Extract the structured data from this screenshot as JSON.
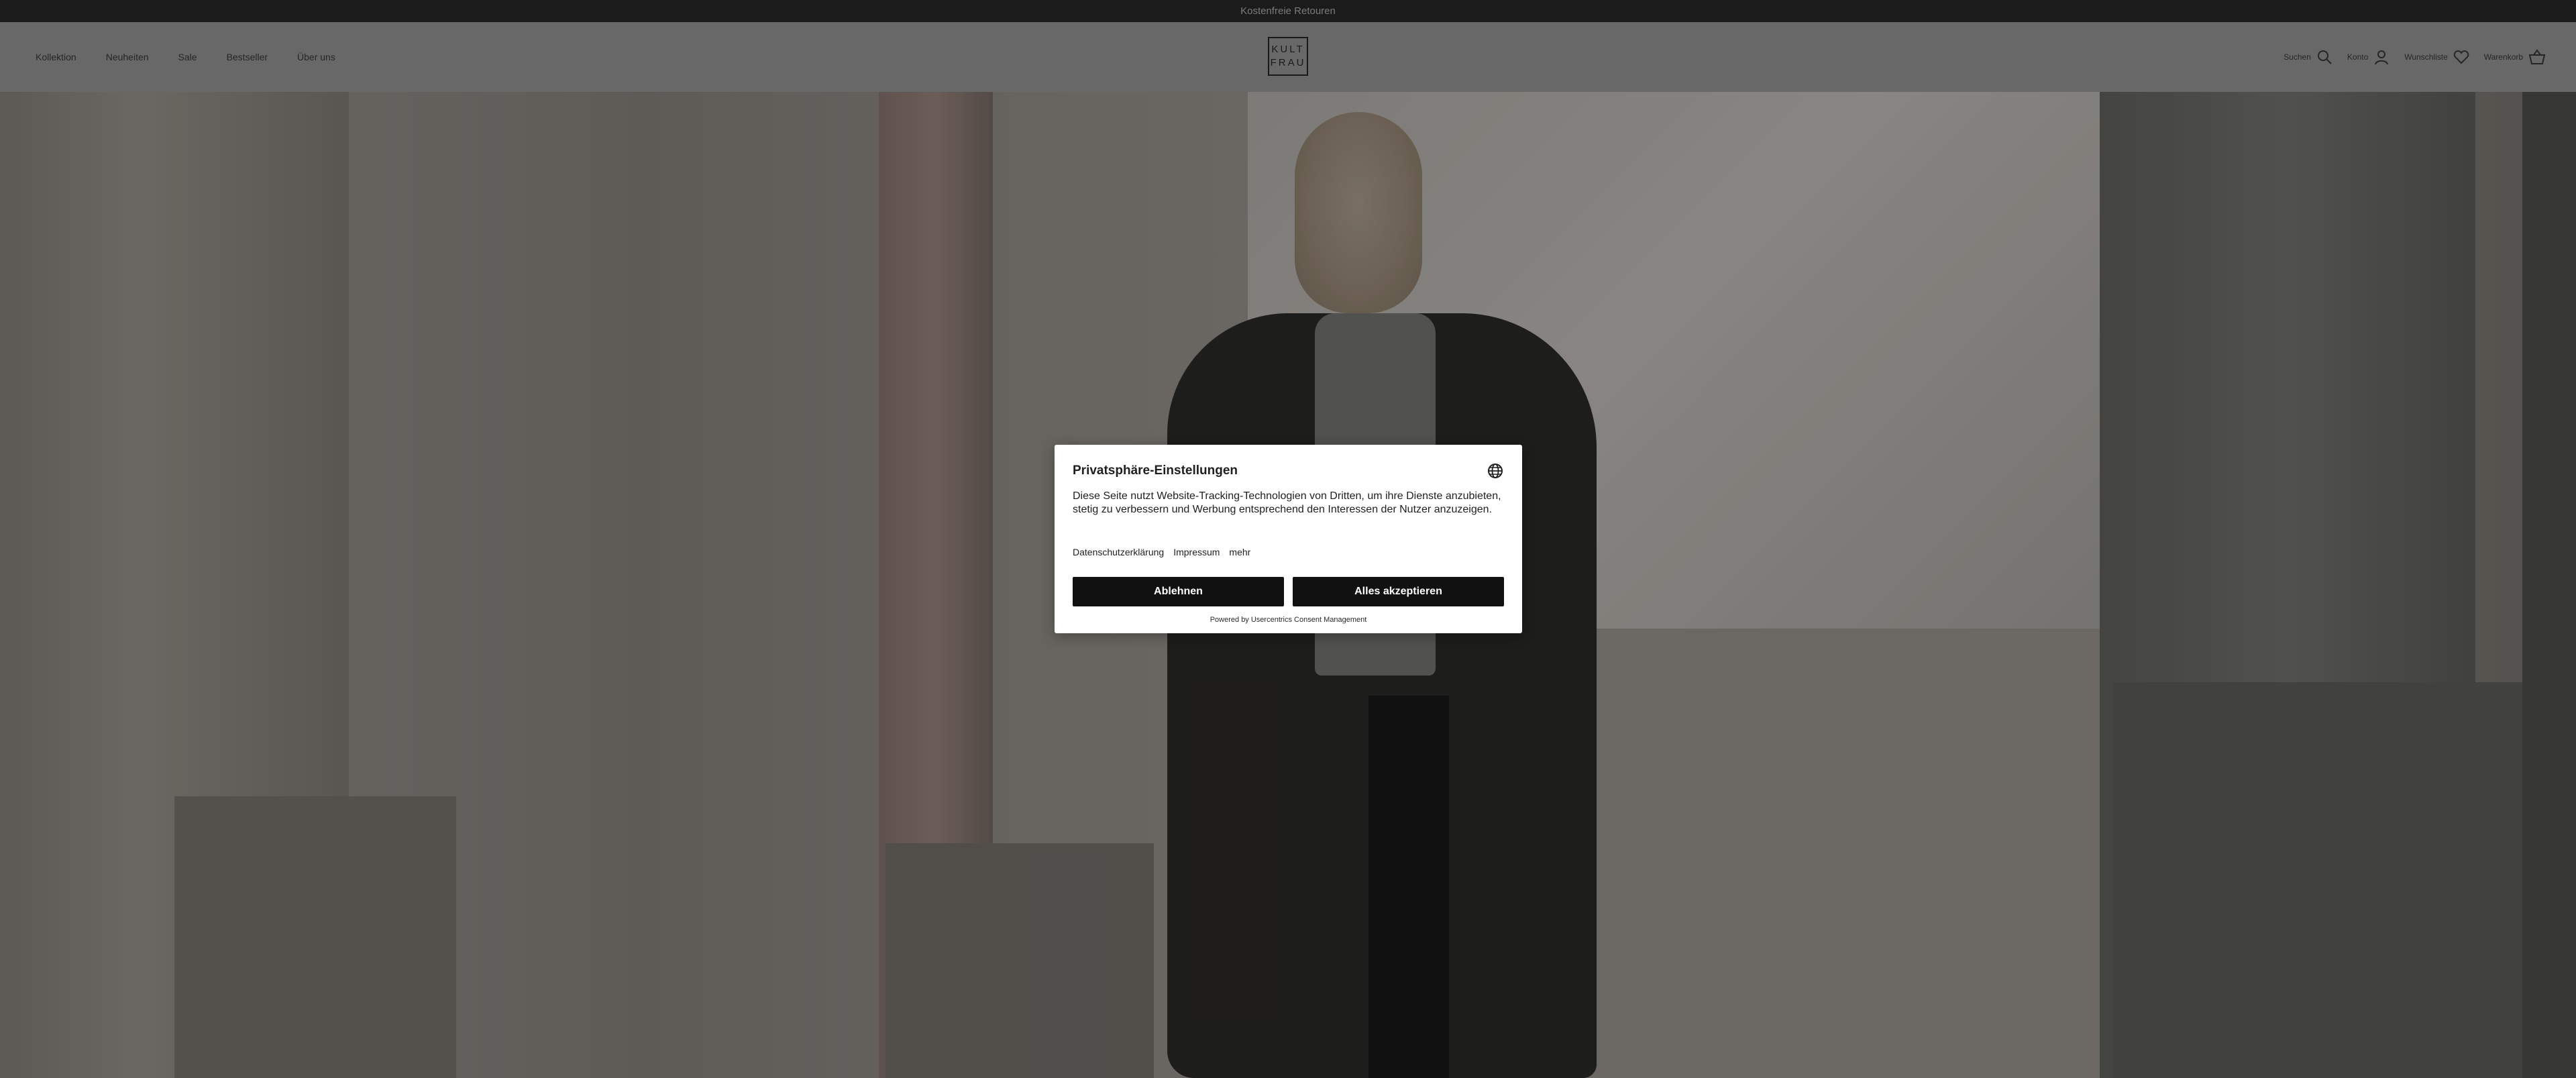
{
  "announcement": {
    "text": "Kostenfreie Retouren"
  },
  "header": {
    "nav": [
      "Kollektion",
      "Neuheiten",
      "Sale",
      "Bestseller",
      "Über uns"
    ],
    "logo": {
      "line1": "KULT",
      "line2": "FRAU"
    },
    "actions": {
      "search": "Suchen",
      "account": "Konto",
      "wishlist": "Wunschliste",
      "cart": "Warenkorb"
    }
  },
  "consent": {
    "title": "Privatsphäre-Einstellungen",
    "body": "Diese Seite nutzt Website-Tracking-Technologien von Dritten, um ihre Dienste anzubieten, stetig zu verbessern und Werbung entsprechend den Interessen der Nutzer anzuzeigen.",
    "links": [
      "Datenschutzerklärung",
      "Impressum",
      "mehr"
    ],
    "reject_label": "Ablehnen",
    "accept_label": "Alles akzeptieren",
    "powered_by": "Powered by Usercentrics Consent Management"
  },
  "colors": {
    "announcement_bg": "#1f1f1f",
    "button_bg": "#111111",
    "dialog_bg": "#ffffff"
  }
}
